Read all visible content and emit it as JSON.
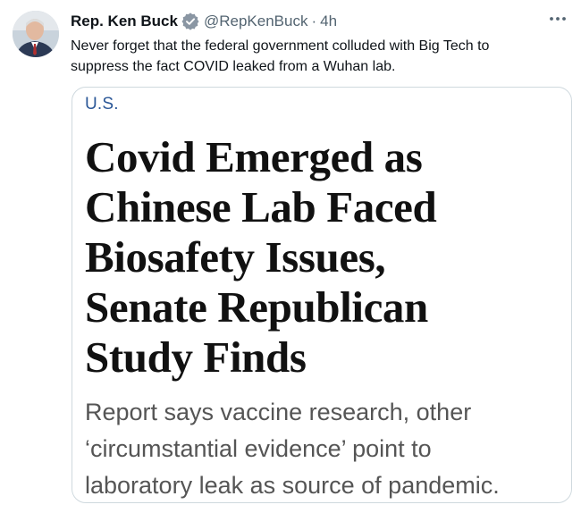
{
  "tweet": {
    "author": {
      "display_name": "Rep. Ken Buck",
      "handle": "@RepKenBuck",
      "separator": "·",
      "timestamp": "4h",
      "verified_icon": "verified-badge-icon",
      "avatar": "avatar-photo"
    },
    "text_lines": [
      "Never forget that the federal government colluded with Big Tech to",
      "suppress the fact COVID leaked from a Wuhan lab."
    ],
    "more_icon": "more-options-icon"
  },
  "card": {
    "section": "U.S.",
    "headline_lines": [
      "Covid Emerged as",
      "Chinese Lab Faced",
      "Biosafety Issues,",
      "Senate Republican",
      "Study Finds"
    ],
    "dek_lines": [
      "Report says vaccine research, other",
      "‘circumstantial evidence’ point to",
      "laboratory leak as source of pandemic."
    ]
  },
  "colors": {
    "verified_badge": "#8a96a3",
    "section_label": "#2b5797",
    "secondary_text": "#536471",
    "card_border": "#cfd9de"
  }
}
